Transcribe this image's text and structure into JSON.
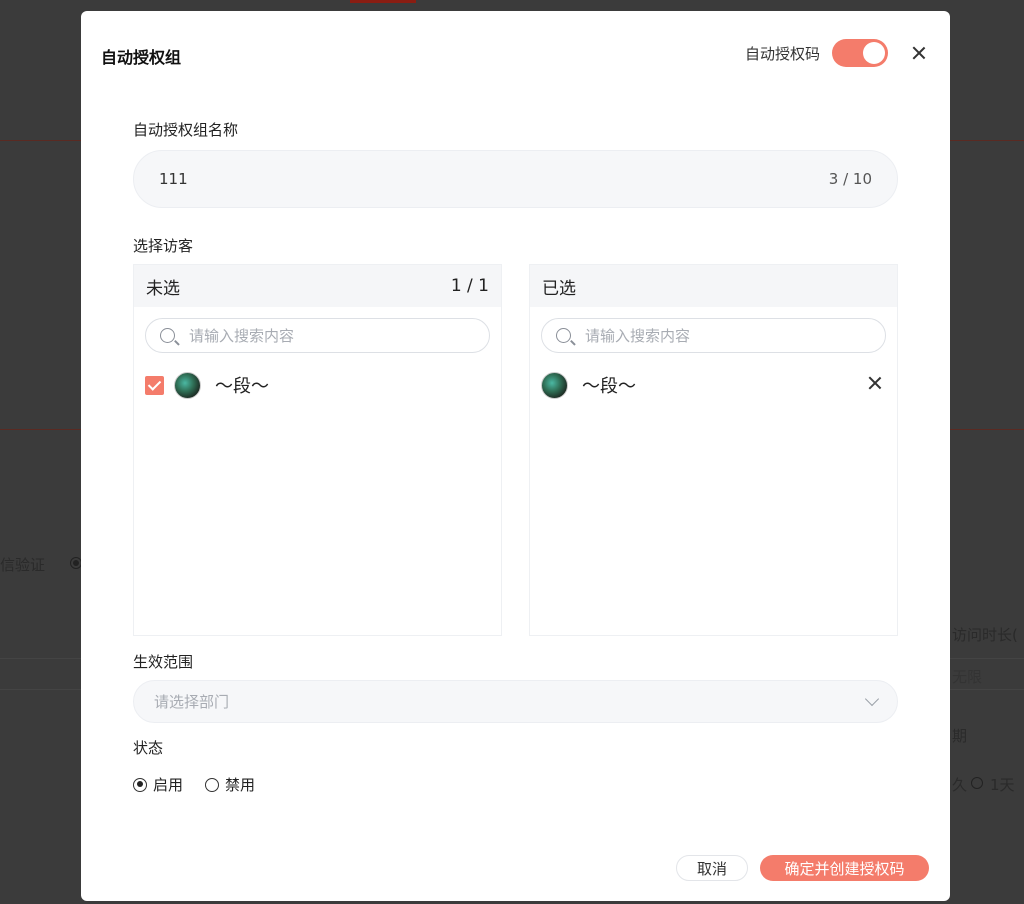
{
  "background": {
    "text_verify": "信验证",
    "text_duration": "访问时长(",
    "text_unlimited": "无限",
    "text_period": "期",
    "text_opt1": "久",
    "text_opt2": "1天"
  },
  "modal": {
    "title": "自动授权组",
    "toggle_label": "自动授权码",
    "toggle_on": true
  },
  "name_field": {
    "label": "自动授权组名称",
    "value": "111",
    "counter": "3 / 10"
  },
  "visitors": {
    "label": "选择访客",
    "unselected": {
      "title": "未选",
      "count": "1 / 1",
      "search_placeholder": "请输入搜索内容",
      "items": [
        {
          "name": "～段～",
          "checked": true
        }
      ]
    },
    "selected": {
      "title": "已选",
      "search_placeholder": "请输入搜索内容",
      "items": [
        {
          "name": "～段～"
        }
      ]
    }
  },
  "scope": {
    "label": "生效范围",
    "placeholder": "请选择部门"
  },
  "status": {
    "label": "状态",
    "options": [
      {
        "label": "启用",
        "checked": true
      },
      {
        "label": "禁用",
        "checked": false
      }
    ]
  },
  "footer": {
    "cancel_label": "取消",
    "confirm_label": "确定并创建授权码"
  },
  "colors": {
    "accent": "#f47c6b",
    "input_bg": "#f6f7f9"
  }
}
